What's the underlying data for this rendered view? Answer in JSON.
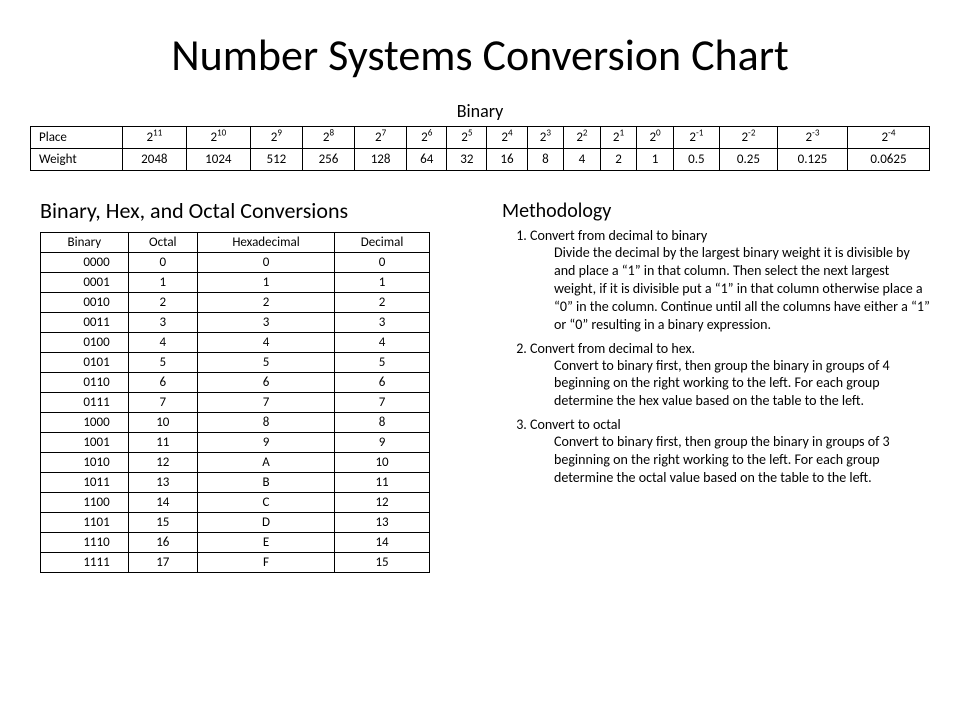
{
  "title": "Number Systems Conversion Chart",
  "binary_caption": "Binary",
  "binary_table": {
    "row1_label": "Place",
    "row2_label": "Weight",
    "places_base": "2",
    "places_exp": [
      "11",
      "10",
      "9",
      "8",
      "7",
      "6",
      "5",
      "4",
      "3",
      "2",
      "1",
      "0",
      "-1",
      "-2",
      "-3",
      "-4"
    ],
    "weights": [
      "2048",
      "1024",
      "512",
      "256",
      "128",
      "64",
      "32",
      "16",
      "8",
      "4",
      "2",
      "1",
      "0.5",
      "0.25",
      "0.125",
      "0.0625"
    ]
  },
  "conv_heading": "Binary, Hex, and Octal Conversions",
  "conv_headers": [
    "Binary",
    "Octal",
    "Hexadecimal",
    "Decimal"
  ],
  "conv_rows": [
    [
      "0000",
      "0",
      "0",
      "0"
    ],
    [
      "0001",
      "1",
      "1",
      "1"
    ],
    [
      "0010",
      "2",
      "2",
      "2"
    ],
    [
      "0011",
      "3",
      "3",
      "3"
    ],
    [
      "0100",
      "4",
      "4",
      "4"
    ],
    [
      "0101",
      "5",
      "5",
      "5"
    ],
    [
      "0110",
      "6",
      "6",
      "6"
    ],
    [
      "0111",
      "7",
      "7",
      "7"
    ],
    [
      "1000",
      "10",
      "8",
      "8"
    ],
    [
      "1001",
      "11",
      "9",
      "9"
    ],
    [
      "1010",
      "12",
      "A",
      "10"
    ],
    [
      "1011",
      "13",
      "B",
      "11"
    ],
    [
      "1100",
      "14",
      "C",
      "12"
    ],
    [
      "1101",
      "15",
      "D",
      "13"
    ],
    [
      "1110",
      "16",
      "E",
      "14"
    ],
    [
      "1111",
      "17",
      "F",
      "15"
    ]
  ],
  "methodology_heading": "Methodology",
  "methodology": [
    {
      "title": "Convert from decimal to binary",
      "body": "Divide the decimal by the largest binary weight it is divisible by and place a “1” in that column. Then select the next largest weight, if it is divisible put a “1” in that column otherwise place a “0” in the column.  Continue until all the columns have either a “1” or “0” resulting in a binary expression."
    },
    {
      "title": "Convert from decimal to hex.",
      "body": "Convert to binary first, then group the binary in groups of 4 beginning on the right working to the left.  For each group determine the hex value based on the table to the left."
    },
    {
      "title": "Convert to octal",
      "body": "Convert to binary first, then group the binary in groups of 3 beginning on the right working to the left.  For each group determine the octal value based on the table to the left."
    }
  ]
}
